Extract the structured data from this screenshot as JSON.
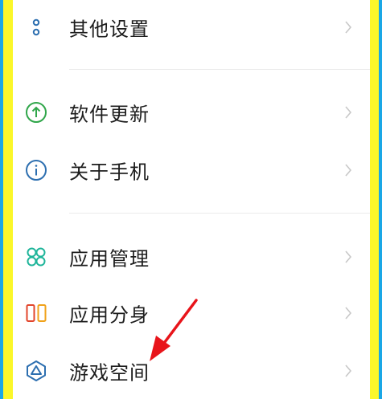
{
  "menu": {
    "items": [
      {
        "label": "其他设置",
        "icon": "more-settings-icon",
        "color": "#2d6fb0"
      },
      {
        "label": "软件更新",
        "icon": "update-icon",
        "color": "#30a64a"
      },
      {
        "label": "关于手机",
        "icon": "info-icon",
        "color": "#2d6fb0"
      },
      {
        "label": "应用管理",
        "icon": "apps-grid-icon",
        "color": "#1fb59a"
      },
      {
        "label": "应用分身",
        "icon": "dual-apps-icon",
        "color": "#f07a1a"
      },
      {
        "label": "游戏空间",
        "icon": "game-space-icon",
        "color": "#2d6fb0"
      }
    ]
  },
  "colors": {
    "frame_outer": "#1aa7e6",
    "frame_inner": "#fbf72a",
    "annotation_arrow": "#e8141a",
    "chevron": "#c8c8c8"
  },
  "annotation": {
    "icon": "red-arrow-icon",
    "points_to": "游戏空间"
  }
}
